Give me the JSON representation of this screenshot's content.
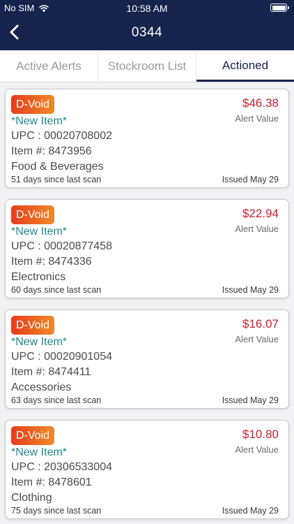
{
  "status_bar": {
    "carrier": "No SIM",
    "time": "10:58 AM"
  },
  "header": {
    "title": "0344",
    "back_icon": "chevron-left-icon"
  },
  "tabs": [
    {
      "label": "Active Alerts",
      "active": false
    },
    {
      "label": "Stockroom List",
      "active": false
    },
    {
      "label": "Actioned",
      "active": true
    }
  ],
  "alerts": [
    {
      "badge": "D-Void",
      "value": "$46.38",
      "value_label": "Alert Value",
      "new_item": "*New Item*",
      "upc": "UPC : 00020708002",
      "item_number": "Item #: 8473956",
      "department": "Food & Beverages",
      "days_since_scan": "51 days since last scan",
      "issued": "Issued May 29"
    },
    {
      "badge": "D-Void",
      "value": "$22.94",
      "value_label": "Alert Value",
      "new_item": "*New Item*",
      "upc": "UPC : 00020877458",
      "item_number": "Item #: 8474336",
      "department": "Electronics",
      "days_since_scan": "60 days since last scan",
      "issued": "Issued May 29"
    },
    {
      "badge": "D-Void",
      "value": "$16.07",
      "value_label": "Alert Value",
      "new_item": "*New Item*",
      "upc": "UPC : 00020901054",
      "item_number": "Item #: 8474411",
      "department": "Accessories",
      "days_since_scan": "63 days since last scan",
      "issued": "Issued May 29"
    },
    {
      "badge": "D-Void",
      "value": "$10.80",
      "value_label": "Alert Value",
      "new_item": "*New Item*",
      "upc": "UPC : 20306533004",
      "item_number": "Item #: 8478601",
      "department": "Clothing",
      "days_since_scan": "75 days since last scan",
      "issued": "Issued May 29"
    }
  ],
  "colors": {
    "header_bg": "#15234d",
    "price": "#c8202f",
    "new_item": "#1f8a8e",
    "badge_start": "#e63c1e",
    "badge_end": "#f08a25"
  }
}
